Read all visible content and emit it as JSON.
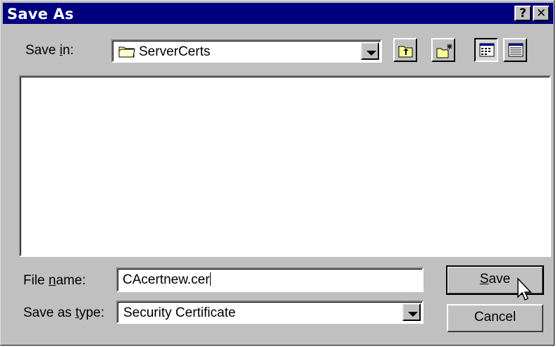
{
  "window": {
    "title": "Save As",
    "help_label": "?",
    "close_label": "✕"
  },
  "save_in": {
    "label_pre": "Save ",
    "label_key": "i",
    "label_post": "n:",
    "folder": "ServerCerts",
    "folder_icon": "folder-icon"
  },
  "toolbar": {
    "up_icon": "up-one-level-icon",
    "new_folder_icon": "new-folder-icon",
    "list_icon": "list-view-icon",
    "details_icon": "details-view-icon"
  },
  "file_name": {
    "label_pre": "File ",
    "label_key": "n",
    "label_post": "ame:",
    "value": "CAcertnew.cer"
  },
  "save_type": {
    "label_pre": "Save as ",
    "label_key": "t",
    "label_post": "ype:",
    "value": "Security Certificate"
  },
  "buttons": {
    "save_key": "S",
    "save_rest": "ave",
    "cancel": "Cancel"
  },
  "colors": {
    "titlebar": "#000080",
    "face": "#c0c0c0",
    "field": "#ffffff"
  }
}
